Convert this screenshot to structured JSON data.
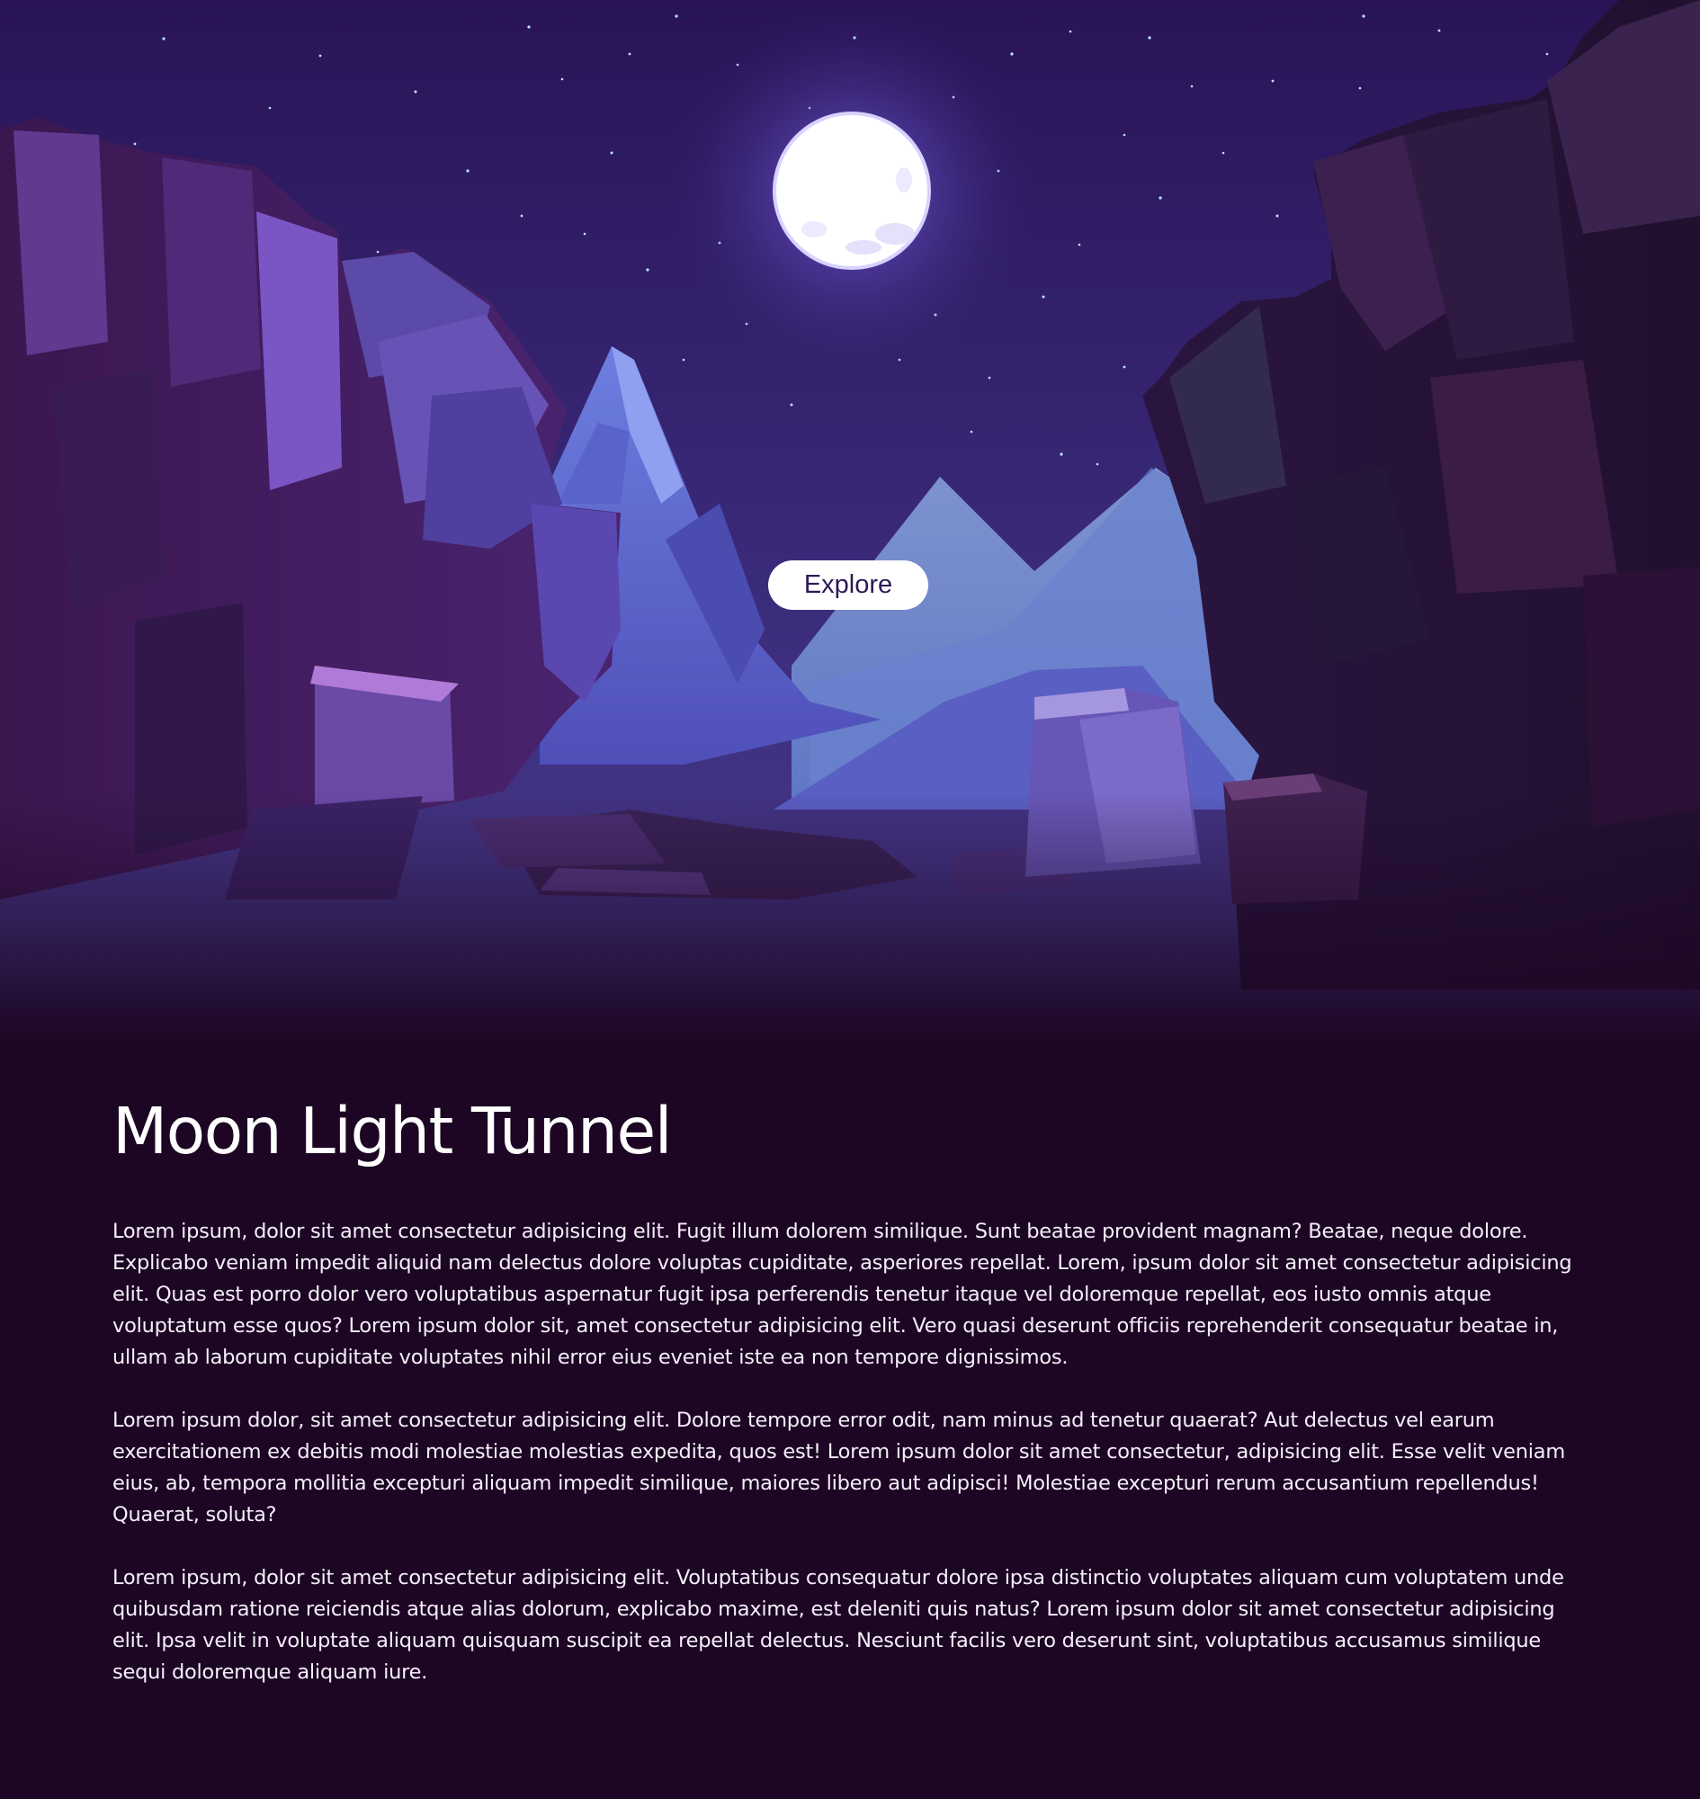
{
  "hero": {
    "explore_label": "Explore"
  },
  "article": {
    "title": "Moon Light Tunnel",
    "paragraphs": [
      "Lorem ipsum, dolor sit amet consectetur adipisicing elit. Fugit illum dolorem similique. Sunt beatae provident magnam? Beatae, neque dolore. Explicabo veniam impedit aliquid nam delectus dolore voluptas cupiditate, asperiores repellat. Lorem, ipsum dolor sit amet consectetur adipisicing elit. Quas est porro dolor vero voluptatibus aspernatur fugit ipsa perferendis tenetur itaque vel doloremque repellat, eos iusto omnis atque voluptatum esse quos? Lorem ipsum dolor sit, amet consectetur adipisicing elit. Vero quasi deserunt officiis reprehenderit consequatur beatae in, ullam ab laborum cupiditate voluptates nihil error eius eveniet iste ea non tempore dignissimos.",
      "Lorem ipsum dolor, sit amet consectetur adipisicing elit. Dolore tempore error odit, nam minus ad tenetur quaerat? Aut delectus vel earum exercitationem ex debitis modi molestiae molestias expedita, quos est! Lorem ipsum dolor sit amet consectetur, adipisicing elit. Esse velit veniam eius, ab, tempora mollitia excepturi aliquam impedit similique, maiores libero aut adipisci! Molestiae excepturi rerum accusantium repellendus! Quaerat, soluta?",
      "Lorem ipsum, dolor sit amet consectetur adipisicing elit. Voluptatibus consequatur dolore ipsa distinctio voluptates aliquam cum voluptatem unde quibusdam ratione reiciendis atque alias dolorum, explicabo maxime, est deleniti quis natus? Lorem ipsum dolor sit amet consectetur adipisicing elit. Ipsa velit in voluptate aliquam quisquam suscipit ea repellat delectus. Nesciunt facilis vero deserunt sint, voluptatibus accusamus similique sequi doloremque aliquam iure."
    ]
  },
  "colors": {
    "page_background": "#1c0623",
    "sky_top": "#2a1457",
    "button_background": "#ffffff",
    "button_text": "#2b1a55",
    "text": "#ffffff"
  }
}
